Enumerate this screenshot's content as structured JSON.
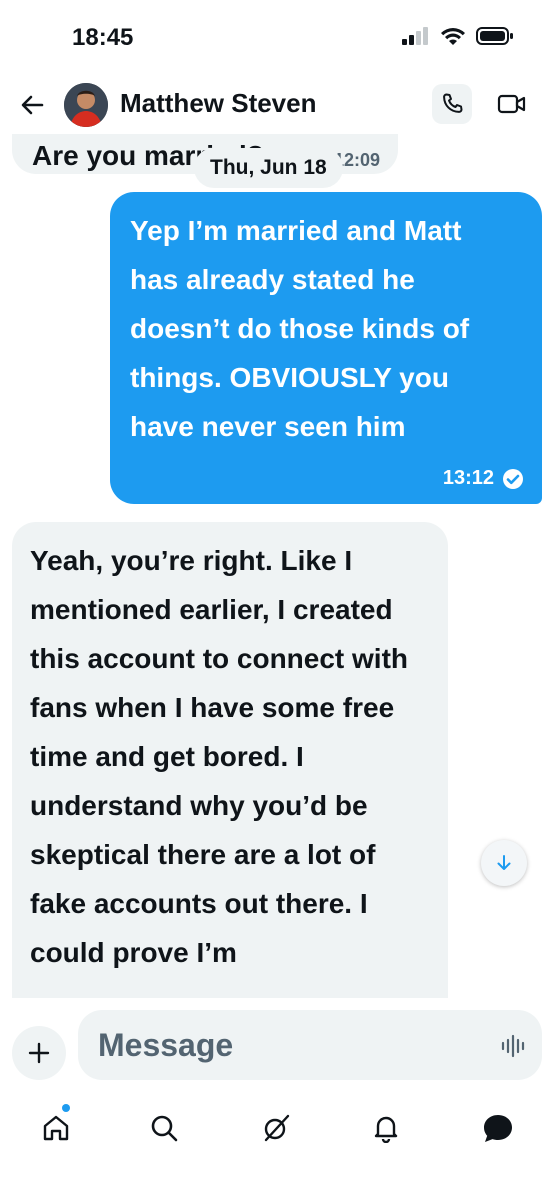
{
  "status_bar": {
    "time": "18:45",
    "icons": [
      "cellular-signal-icon",
      "wifi-icon",
      "battery-icon"
    ]
  },
  "header": {
    "contact_name": "Matthew Steven",
    "back_icon": "arrow-left-icon",
    "call_icon": "phone-icon",
    "video_icon": "video-camera-icon"
  },
  "chat": {
    "previous_message": {
      "text": "Are you married?",
      "time": "12:09"
    },
    "date_separator": "Thu, Jun 18",
    "messages": [
      {
        "direction": "outgoing",
        "text": "Yep I’m married and Matt has already stated he doesn’t do those kinds of things. OBVIOUSLY you have never seen him",
        "time": "13:12",
        "status_icon": "read-check-icon"
      },
      {
        "direction": "incoming",
        "text": "Yeah, you’re right. Like I mentioned earlier, I created this account to connect with fans when I have some free time and get bored. I understand why you’d be skeptical there are a lot of fake accounts out there. I could prove I’m"
      }
    ]
  },
  "composer": {
    "placeholder": "Message",
    "value": "",
    "add_icon": "plus-icon",
    "voice_icon": "voice-wave-icon"
  },
  "tab_bar": {
    "items": [
      "home-icon",
      "search-icon",
      "grok-icon",
      "notifications-bell-icon",
      "messages-icon"
    ],
    "active": "messages-icon",
    "home_badge": true
  },
  "colors": {
    "accent": "#1d9bf0",
    "bubble_incoming": "#eff3f4",
    "text_primary": "#0f1419",
    "text_secondary": "#536471"
  }
}
